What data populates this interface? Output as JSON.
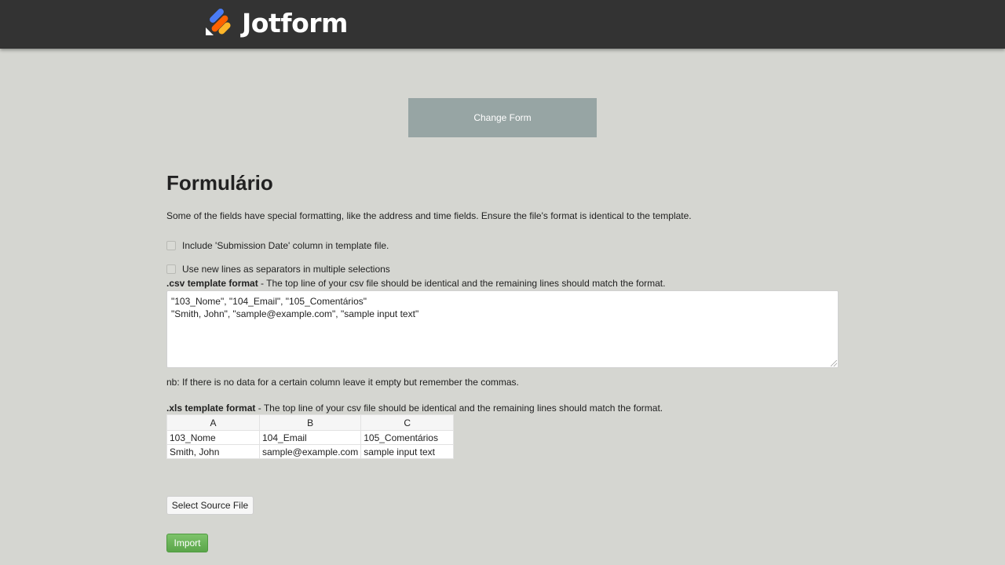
{
  "header": {
    "logo_text": "Jotform",
    "logo_icon": "jotform-logo-icon"
  },
  "change_form_label": "Change Form",
  "form_title": "Formulário",
  "description": "Some of the fields have special formatting, like the address and time fields. Ensure the file's format is identical to the template.",
  "options": {
    "submission_date": "Include 'Submission Date' column in template file.",
    "new_lines": "Use new lines as separators in multiple selections"
  },
  "csv": {
    "label_bold": ".csv template format",
    "label_rest": " - The top line of your csv file should be identical and the remaining lines should match the format.",
    "line1": "\"103_Nome\", \"104_Email\", \"105_Comentários\"",
    "line2": "\"Smith, John\", \"sample@example.com\", \"sample input text\""
  },
  "nb": "nb: If there is no data for a certain column leave it empty but remember the commas.",
  "xls": {
    "label_bold": ".xls template format",
    "label_rest": " - The top line of your csv file should be identical and the remaining lines should match the format.",
    "columns": [
      "A",
      "B",
      "C"
    ],
    "rows": [
      [
        "103_Nome",
        "104_Email",
        "105_Comentários"
      ],
      [
        "Smith, John",
        "sample@example.com",
        "sample input text"
      ]
    ]
  },
  "buttons": {
    "select_source": "Select Source File",
    "import": "Import"
  },
  "colors": {
    "topbar": "#333333",
    "background": "#d5d6d1",
    "change_form": "#97a5a4",
    "import": "#5aa54a",
    "logo_blue": "#4a7cf6",
    "logo_orange": "#ff6100",
    "logo_yellow": "#ffb629"
  }
}
